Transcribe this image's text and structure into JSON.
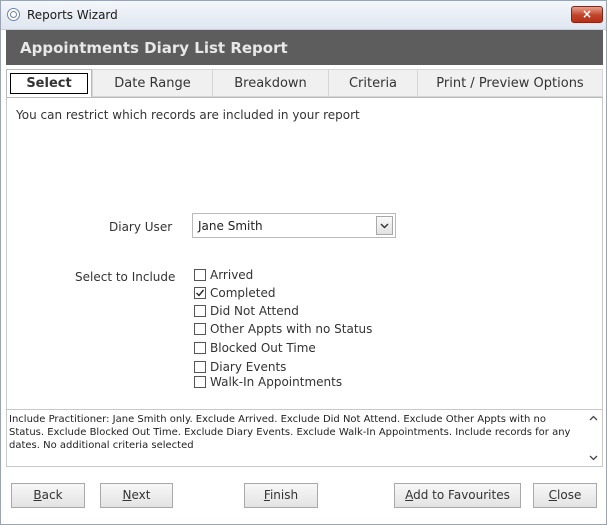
{
  "window": {
    "title": "Reports Wizard",
    "close_label": "×"
  },
  "banner": {
    "title": "Appointments Diary List Report"
  },
  "tabs": [
    {
      "label": "Select",
      "active": true
    },
    {
      "label": "Date Range",
      "active": false
    },
    {
      "label": "Breakdown",
      "active": false
    },
    {
      "label": "Criteria",
      "active": false
    },
    {
      "label": "Print / Preview Options",
      "active": false
    }
  ],
  "select_tab": {
    "intro": "You can restrict which records are included in your report",
    "diary_user_label": "Diary User",
    "diary_user_value": "Jane Smith",
    "include_label": "Select to Include",
    "options": [
      {
        "label": "Arrived",
        "checked": false
      },
      {
        "label": "Completed",
        "checked": true
      },
      {
        "label": "Did Not Attend",
        "checked": false
      },
      {
        "label": "Other Appts with no Status",
        "checked": false
      },
      {
        "label": "Blocked Out Time",
        "checked": false
      },
      {
        "label": "Diary Events",
        "checked": false
      },
      {
        "label": "Walk-In Appointments",
        "checked": false
      }
    ]
  },
  "summary": {
    "text": "Include Practitioner: Jane Smith only. Exclude Arrived. Exclude Did Not Attend. Exclude Other Appts with no Status. Exclude Blocked Out Time. Exclude Diary Events. Exclude Walk-In Appointments. Include records for any dates. No additional criteria selected"
  },
  "footer": {
    "back_first": "B",
    "back_rest": "ack",
    "next_first": "N",
    "next_rest": "ext",
    "finish_first": "F",
    "finish_rest": "inish",
    "fav_pre": "",
    "fav_first": "A",
    "fav_rest": "dd to Favourites",
    "close_first": "C",
    "close_rest": "lose"
  }
}
